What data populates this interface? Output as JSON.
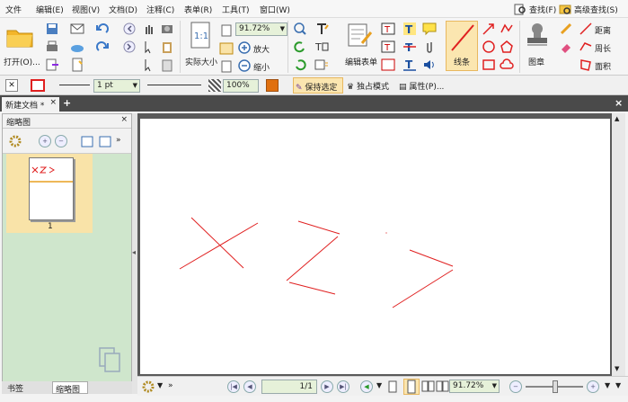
{
  "menu": {
    "items": [
      "文件",
      "编辑(E)",
      "视图(V)",
      "文档(D)",
      "注释(C)",
      "表单(R)",
      "工具(T)",
      "窗口(W)"
    ],
    "find": "查找(F)",
    "advanced_find": "高级查找(S)"
  },
  "ribbon": {
    "open_label": "打开(O)...",
    "actual_size_label": "实际大小",
    "zoom_value": "91.72%",
    "zoom_in_label": "放大",
    "zoom_out_label": "缩小",
    "edit_form_label": "编辑表单",
    "line_label": "线条",
    "stamp_label": "图章",
    "distance_label": "距离",
    "perimeter_label": "周长",
    "area_label": "面积"
  },
  "propbar": {
    "line_width": "1 pt",
    "opacity": "100%",
    "keep_selected": "保持选定",
    "exclusive_mode": "独占模式",
    "properties": "属性(P)..."
  },
  "tabs": {
    "doc_title": "新建文档 *",
    "close": "×",
    "add": "+"
  },
  "left_panel": {
    "title": "缩略图",
    "thumb_page_number": "1",
    "bottom_tab_bookmarks": "书签",
    "bottom_tab_thumbnails": "缩略图"
  },
  "status": {
    "page_field": "1/1",
    "zoom_value": "91.72%"
  },
  "colors": {
    "accent_green": "#e6f1d9",
    "highlight_orange": "#f9e3a8",
    "ink_red": "#e02020"
  }
}
